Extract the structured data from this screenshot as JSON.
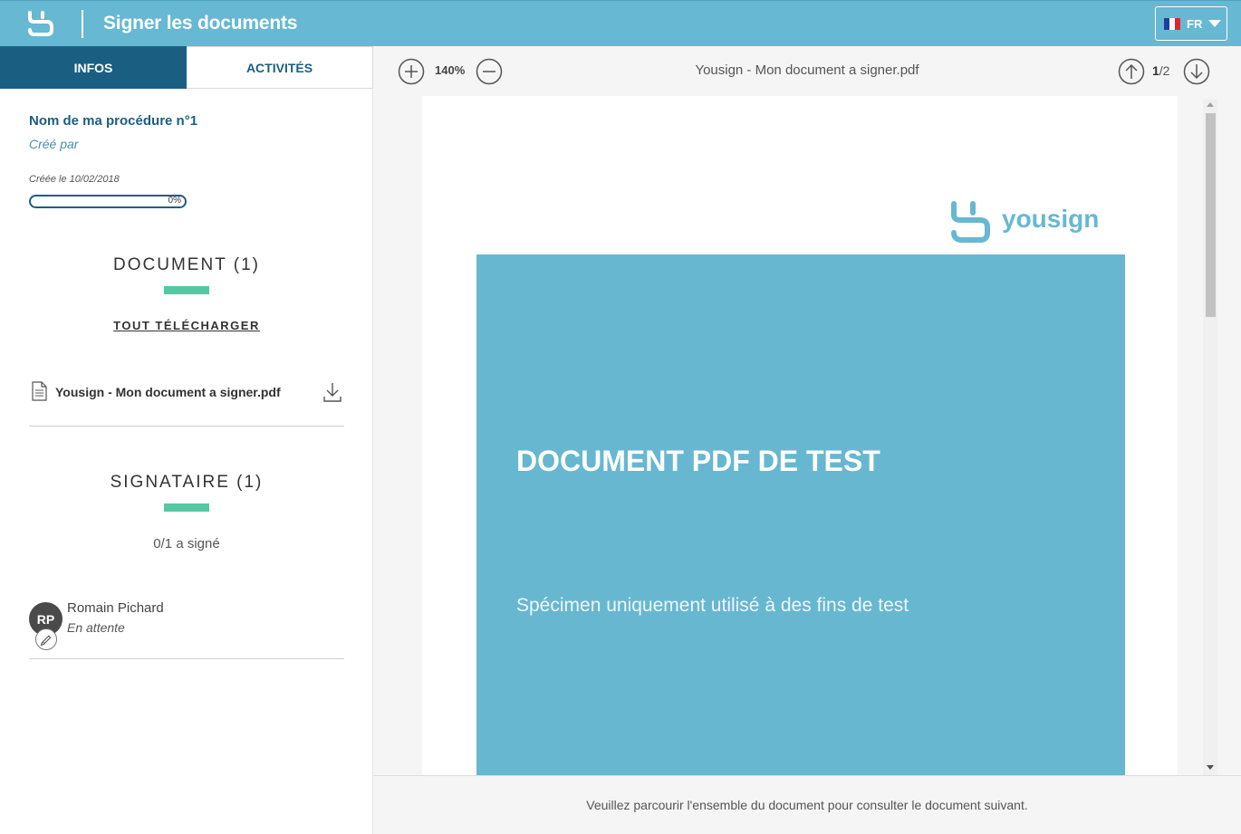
{
  "header": {
    "title": "Signer les documents",
    "logo_icon": "yousign-logo-icon",
    "language": {
      "code": "FR",
      "flag": "france-flag-icon"
    }
  },
  "sidebar": {
    "tabs": [
      {
        "label": "INFOS",
        "active": true
      },
      {
        "label": "ACTIVITÉS",
        "active": false
      }
    ],
    "procedure": {
      "name": "Nom de ma procédure n°1",
      "created_by": "Créé par",
      "created_on": "Créée le 10/02/2018",
      "progress_label": "0%",
      "progress_value": 0
    },
    "documents": {
      "title": "DOCUMENT (1)",
      "download_all": "TOUT TÉLÉCHARGER",
      "items": [
        {
          "name": "Yousign - Mon document a signer.pdf"
        }
      ]
    },
    "signers": {
      "title": "SIGNATAIRE (1)",
      "count_label": "0/1 a signé",
      "items": [
        {
          "initials": "RP",
          "name": "Romain Pichard",
          "status": "En attente"
        }
      ]
    }
  },
  "viewer": {
    "zoom": "140%",
    "document_title": "Yousign - Mon document a signer.pdf",
    "page_current": "1",
    "page_total": "/2",
    "pdf": {
      "logo_text": "yousign",
      "heading": "DOCUMENT PDF DE TEST",
      "subtitle": "Spécimen uniquement utilisé à des fins de test"
    }
  },
  "footer": {
    "message": "Veuillez parcourir l'ensemble du document pour consulter le document suivant."
  },
  "colors": {
    "header_bg": "#67b8d2",
    "tab_active_bg": "#1a5f82",
    "accent_green": "#55c8a3",
    "pdf_blue": "#67b7d1"
  }
}
